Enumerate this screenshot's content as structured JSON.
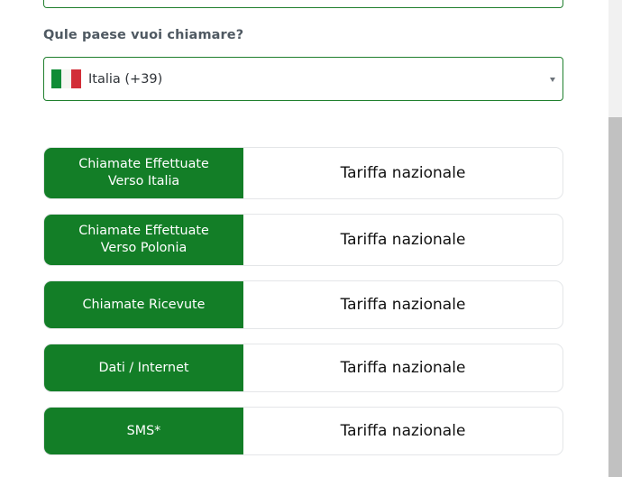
{
  "form": {
    "question": "Qule paese vuoi chiamare?",
    "country": {
      "flag_icon": "italy-flag-icon",
      "flag_colors": [
        "#0f8c36",
        "#f4f5f0",
        "#d22e38"
      ],
      "selected": "Italia (+39)"
    }
  },
  "rates": [
    {
      "label": "Chiamate Effettuate\nVerso Italia",
      "value": "Tariffa nazionale"
    },
    {
      "label": "Chiamate Effettuate\nVerso Polonia",
      "value": "Tariffa nazionale"
    },
    {
      "label": "Chiamate Ricevute",
      "value": "Tariffa nazionale"
    },
    {
      "label": "Dati / Internet",
      "value": "Tariffa nazionale"
    },
    {
      "label": "SMS*",
      "value": "Tariffa nazionale"
    }
  ],
  "colors": {
    "accent_green": "#137e27",
    "border_green": "#1f7f2d",
    "label_gray": "#4f5962"
  }
}
